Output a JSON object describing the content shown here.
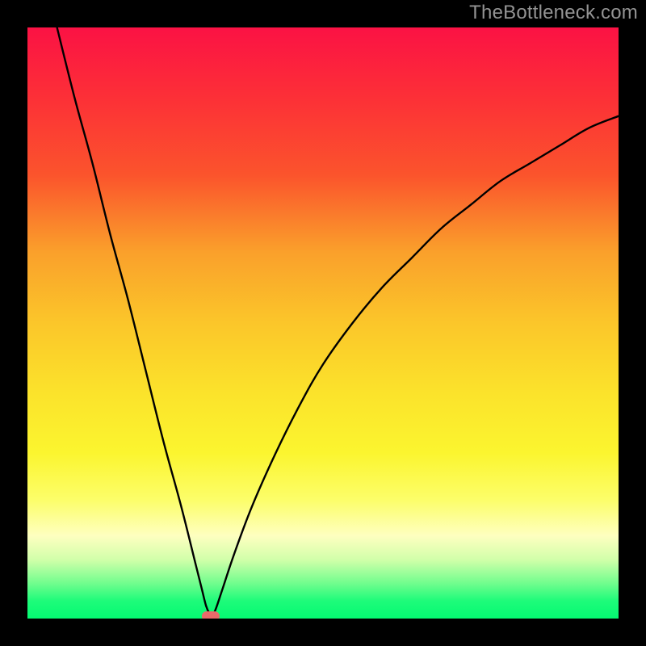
{
  "watermark": "TheBottleneck.com",
  "accent_marker_color": "#e86a6a",
  "curve_color": "#000000",
  "frame_color": "#000000",
  "gradient_stops": [
    {
      "offset": 0.0,
      "color": "#fb1244"
    },
    {
      "offset": 0.12,
      "color": "#fc3037"
    },
    {
      "offset": 0.25,
      "color": "#fb542c"
    },
    {
      "offset": 0.38,
      "color": "#faa02b"
    },
    {
      "offset": 0.5,
      "color": "#fbc62a"
    },
    {
      "offset": 0.62,
      "color": "#fbe32b"
    },
    {
      "offset": 0.72,
      "color": "#fbf52f"
    },
    {
      "offset": 0.8,
      "color": "#fcfe6a"
    },
    {
      "offset": 0.86,
      "color": "#feffc0"
    },
    {
      "offset": 0.9,
      "color": "#d2ffaa"
    },
    {
      "offset": 0.94,
      "color": "#72fd8e"
    },
    {
      "offset": 0.97,
      "color": "#1efb7a"
    },
    {
      "offset": 1.0,
      "color": "#04fa72"
    }
  ],
  "chart_data": {
    "type": "line",
    "title": "",
    "xlabel": "",
    "ylabel": "",
    "xlim": [
      0,
      100
    ],
    "ylim": [
      0,
      100
    ],
    "grid": false,
    "series": [
      {
        "name": "bottleneck-curve",
        "x": [
          5,
          8,
          11,
          14,
          17,
          20,
          23,
          26,
          28.5,
          29.5,
          30.2,
          30.8,
          31.2,
          31.5,
          32,
          33,
          35,
          38,
          42,
          46,
          50,
          55,
          60,
          65,
          70,
          75,
          80,
          85,
          90,
          95,
          100
        ],
        "y": [
          100,
          88,
          77,
          65,
          54,
          42,
          30,
          19,
          9,
          5,
          2.2,
          0.8,
          0.4,
          0.8,
          2,
          5,
          11,
          19,
          28,
          36,
          43,
          50,
          56,
          61,
          66,
          70,
          74,
          77,
          80,
          83,
          85
        ]
      }
    ],
    "annotations": [
      {
        "type": "marker",
        "x": 31.0,
        "y": 0.4,
        "shape": "pill",
        "color": "#e86a6a"
      }
    ]
  }
}
